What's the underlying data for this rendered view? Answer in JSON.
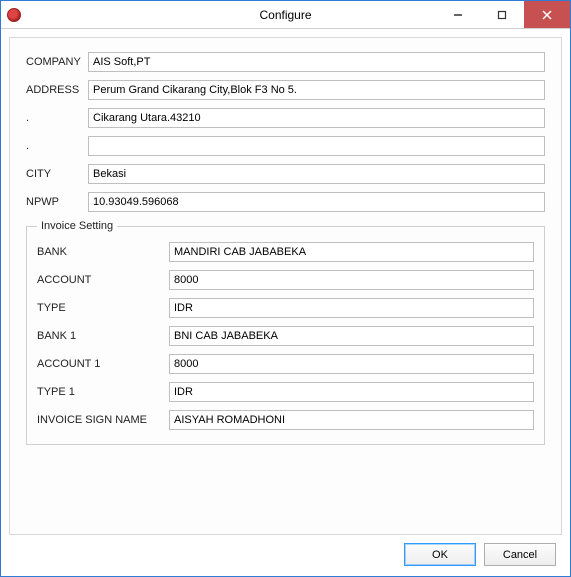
{
  "window": {
    "title": "Configure"
  },
  "fields": {
    "company_label": "COMPANY",
    "company_value": "AIS Soft,PT",
    "address_label": "ADDRESS",
    "address_value": "Perum Grand Cikarang City,Blok F3 No 5.",
    "address2_label": ".",
    "address2_value": "Cikarang Utara.43210",
    "address3_label": ".",
    "address3_value": "",
    "city_label": "CITY",
    "city_value": "Bekasi",
    "npwp_label": "NPWP",
    "npwp_value": "10.93049.596068"
  },
  "invoice": {
    "legend": "Invoice Setting",
    "bank_label": "BANK",
    "bank_value": "MANDIRI CAB JABABEKA",
    "account_label": "ACCOUNT",
    "account_value": "8000",
    "type_label": "TYPE",
    "type_value": "IDR",
    "bank1_label": "BANK 1",
    "bank1_value": "BNI CAB JABABEKA",
    "account1_label": "ACCOUNT 1",
    "account1_value": "8000",
    "type1_label": "TYPE 1",
    "type1_value": "IDR",
    "sign_label": "INVOICE SIGN NAME",
    "sign_value": "AISYAH ROMADHONI"
  },
  "buttons": {
    "ok": "OK",
    "cancel": "Cancel"
  }
}
